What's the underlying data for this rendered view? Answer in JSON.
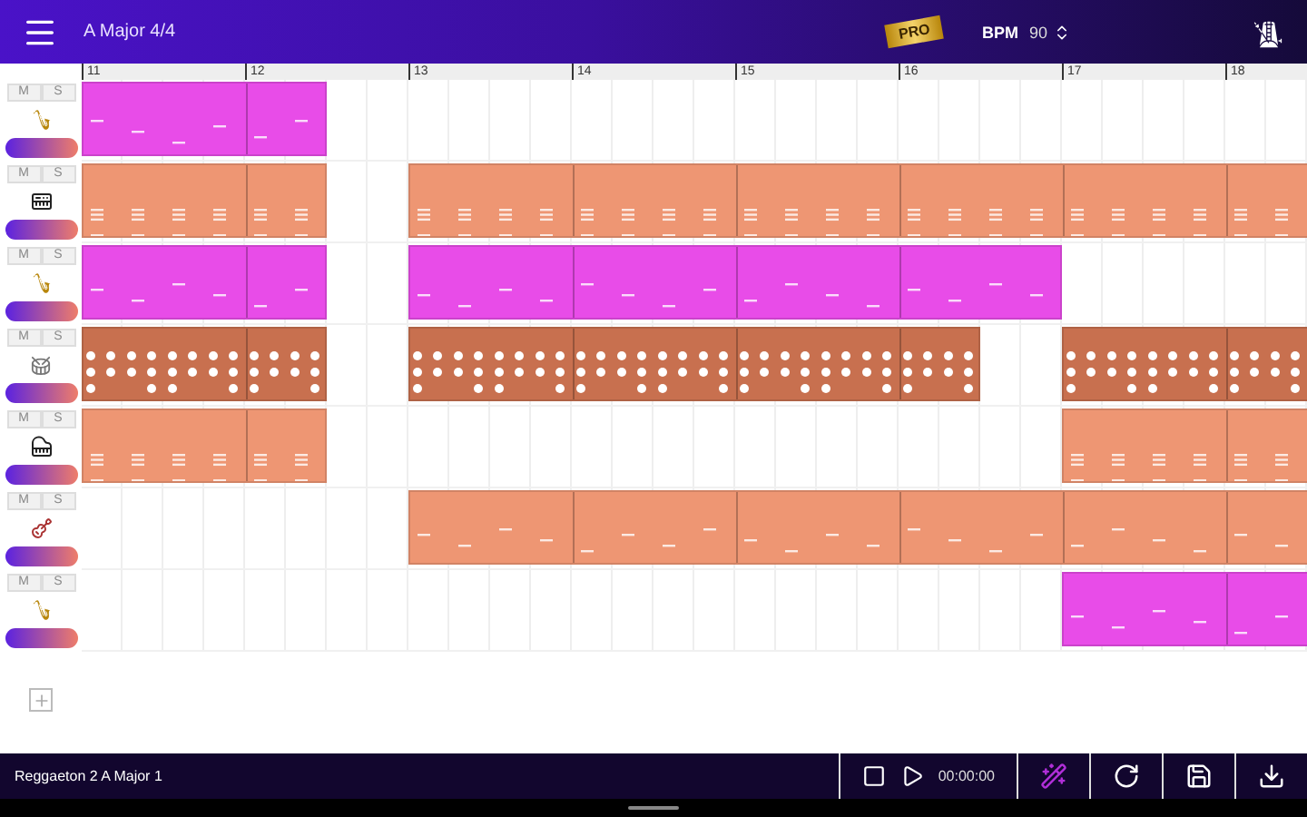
{
  "top_bar": {
    "title": "A Major 4/4",
    "badge": "PRO",
    "bpm_label": "BPM",
    "bpm_value": "90"
  },
  "ruler": [
    "11",
    "12",
    "13",
    "14",
    "15",
    "16",
    "17",
    "18"
  ],
  "tracks": [
    {
      "mute": "M",
      "solo": "S",
      "kind": "sax",
      "color": "#e84ce8",
      "bars": [
        {
          "kind": "full"
        },
        {
          "kind": "half"
        },
        {
          "kind": "empty"
        },
        {
          "kind": "empty"
        },
        {
          "kind": "empty"
        },
        {
          "kind": "empty"
        },
        {
          "kind": "empty"
        },
        {
          "kind": "empty"
        }
      ]
    },
    {
      "mute": "M",
      "solo": "S",
      "kind": "keys",
      "color": "#ee9673",
      "bars": [
        {
          "kind": "full"
        },
        {
          "kind": "half"
        },
        {
          "kind": "full"
        },
        {
          "kind": "full"
        },
        {
          "kind": "full"
        },
        {
          "kind": "full"
        },
        {
          "kind": "full"
        },
        {
          "kind": "full"
        }
      ]
    },
    {
      "mute": "M",
      "solo": "S",
      "kind": "sax",
      "color": "#e84ce8",
      "bars": [
        {
          "kind": "full"
        },
        {
          "kind": "half"
        },
        {
          "kind": "full"
        },
        {
          "kind": "full"
        },
        {
          "kind": "full"
        },
        {
          "kind": "full"
        },
        {
          "kind": "empty"
        },
        {
          "kind": "empty"
        }
      ]
    },
    {
      "mute": "M",
      "solo": "S",
      "kind": "drums",
      "color": "#c8704f",
      "bars": [
        {
          "kind": "full"
        },
        {
          "kind": "half"
        },
        {
          "kind": "full"
        },
        {
          "kind": "full"
        },
        {
          "kind": "full"
        },
        {
          "kind": "half"
        },
        {
          "kind": "full"
        },
        {
          "kind": "full"
        }
      ]
    },
    {
      "mute": "M",
      "solo": "S",
      "kind": "piano",
      "color": "#ee9673",
      "bars": [
        {
          "kind": "full"
        },
        {
          "kind": "half"
        },
        {
          "kind": "empty"
        },
        {
          "kind": "empty"
        },
        {
          "kind": "empty"
        },
        {
          "kind": "empty"
        },
        {
          "kind": "full"
        },
        {
          "kind": "full"
        }
      ]
    },
    {
      "mute": "M",
      "solo": "S",
      "kind": "guitar",
      "color": "#ee9673",
      "bars": [
        {
          "kind": "empty"
        },
        {
          "kind": "empty"
        },
        {
          "kind": "full"
        },
        {
          "kind": "full"
        },
        {
          "kind": "full"
        },
        {
          "kind": "full"
        },
        {
          "kind": "full"
        },
        {
          "kind": "full"
        }
      ]
    },
    {
      "mute": "M",
      "solo": "S",
      "kind": "sax",
      "color": "#e84ce8",
      "bars": [
        {
          "kind": "empty"
        },
        {
          "kind": "empty"
        },
        {
          "kind": "empty"
        },
        {
          "kind": "empty"
        },
        {
          "kind": "empty"
        },
        {
          "kind": "empty"
        },
        {
          "kind": "full"
        },
        {
          "kind": "full"
        }
      ]
    }
  ],
  "bottom_bar": {
    "song": "Reggaeton 2 A Major 1",
    "time": "00:00:00"
  }
}
